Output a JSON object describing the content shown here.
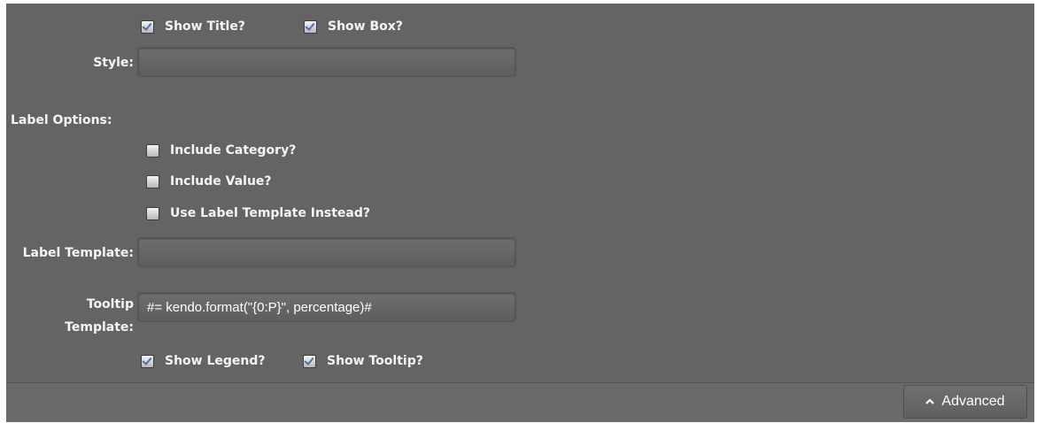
{
  "options": {
    "show_title": {
      "label": "Show Title?",
      "checked": true
    },
    "show_box": {
      "label": "Show Box?",
      "checked": true
    },
    "style_label": "Style:",
    "style_value": "",
    "label_options_heading": "Label Options:",
    "include_category": {
      "label": "Include Category?",
      "checked": false
    },
    "include_value": {
      "label": "Include Value?",
      "checked": false
    },
    "use_label_template": {
      "label": "Use Label Template Instead?",
      "checked": false
    },
    "label_template_label": "Label Template:",
    "label_template_value": "",
    "tooltip_label_line1": "Tooltip",
    "tooltip_label_line2": "Template:",
    "tooltip_template_value": "#= kendo.format(\"{0:P}\", percentage)#",
    "show_legend": {
      "label": "Show Legend?",
      "checked": true
    },
    "show_tooltip": {
      "label": "Show Tooltip?",
      "checked": true
    }
  },
  "footer": {
    "advanced_label": "Advanced",
    "advanced_icon": "chevron-up-icon"
  }
}
